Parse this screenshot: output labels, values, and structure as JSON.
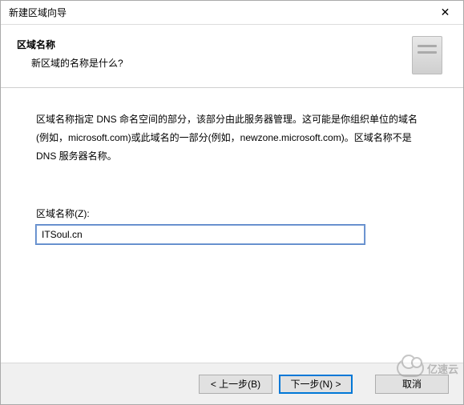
{
  "title": "新建区域向导",
  "header": {
    "heading": "区域名称",
    "subheading": "新区域的名称是什么?"
  },
  "description": "区域名称指定 DNS 命名空间的部分，该部分由此服务器管理。这可能是你组织单位的域名(例如，microsoft.com)或此域名的一部分(例如，newzone.microsoft.com)。区域名称不是 DNS 服务器名称。",
  "field": {
    "label": "区域名称(Z):",
    "value": "ITSoul.cn"
  },
  "buttons": {
    "back": "< 上一步(B)",
    "next": "下一步(N) >",
    "cancel": "取消"
  },
  "watermark": "亿速云",
  "icons": {
    "close": "✕"
  }
}
